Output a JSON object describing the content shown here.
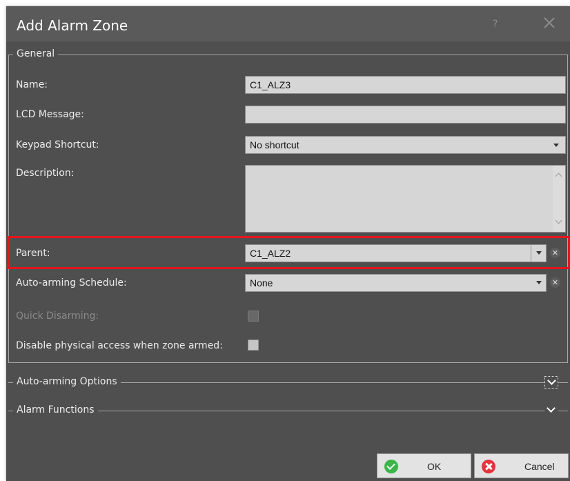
{
  "dialog": {
    "title": "Add Alarm Zone",
    "help_label": "?"
  },
  "general": {
    "legend": "General",
    "name_label": "Name:",
    "name_value": "C1_ALZ3",
    "lcd_label": "LCD Message:",
    "lcd_value": "",
    "keypad_label": "Keypad Shortcut:",
    "keypad_value": "No shortcut",
    "description_label": "Description:",
    "description_value": "",
    "parent_label": "Parent:",
    "parent_value": "C1_ALZ2",
    "autoarm_label": "Auto-arming Schedule:",
    "autoarm_value": "None",
    "quick_disarm_label": "Quick Disarming:",
    "disable_access_label": "Disable physical access when zone armed:"
  },
  "sections": {
    "autoarm_options": "Auto-arming Options",
    "alarm_functions": "Alarm Functions"
  },
  "buttons": {
    "ok": "OK",
    "cancel": "Cancel"
  },
  "colors": {
    "highlight": "#e3161d",
    "dialog_bg": "#4f4f4f",
    "ok_icon": "#3bb44a",
    "cancel_icon": "#e53340"
  }
}
